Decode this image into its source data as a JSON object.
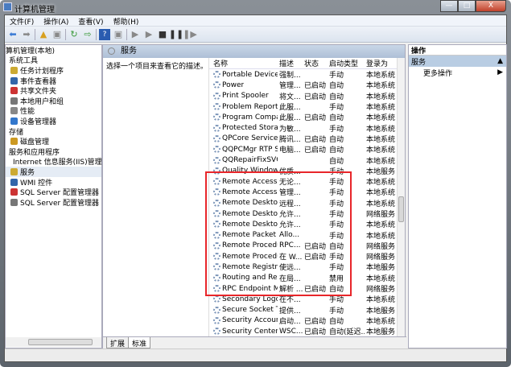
{
  "window": {
    "title": "计算机管理",
    "min": "—",
    "max": "□",
    "close": "X"
  },
  "menu": [
    "文件(F)",
    "操作(A)",
    "查看(V)",
    "帮助(H)"
  ],
  "tree": [
    {
      "label": "算机管理(本地)",
      "level": 0
    },
    {
      "label": "系统工具",
      "level": 1
    },
    {
      "label": "任务计划程序",
      "level": 2
    },
    {
      "label": "事件查看器",
      "level": 2
    },
    {
      "label": "共享文件夹",
      "level": 2
    },
    {
      "label": "本地用户和组",
      "level": 2
    },
    {
      "label": "性能",
      "level": 2
    },
    {
      "label": "设备管理器",
      "level": 2
    },
    {
      "label": "存储",
      "level": 1
    },
    {
      "label": "磁盘管理",
      "level": 2
    },
    {
      "label": "服务和应用程序",
      "level": 1
    },
    {
      "label": "Internet 信息服务(IIS)管理器",
      "level": 2
    },
    {
      "label": "服务",
      "level": 2
    },
    {
      "label": "WMI 控件",
      "level": 2
    },
    {
      "label": "SQL Server 配置管理器",
      "level": 2
    },
    {
      "label": "SQL Server 配置管理器",
      "level": 2
    }
  ],
  "middle": {
    "header": "服务",
    "description": "选择一个项目来查看它的描述。",
    "columns": [
      "名称",
      "描述",
      "状态",
      "启动类型",
      "登录为"
    ],
    "rows": [
      [
        "Portable Device ...",
        "强制...",
        "",
        "手动",
        "本地系统"
      ],
      [
        "Power",
        "管理...",
        "已启动",
        "自动",
        "本地系统"
      ],
      [
        "Print Spooler",
        "将文...",
        "已启动",
        "自动",
        "本地系统"
      ],
      [
        "Problem Report...",
        "此服...",
        "",
        "手动",
        "本地系统"
      ],
      [
        "Program Compa...",
        "此服...",
        "已启动",
        "自动",
        "本地系统"
      ],
      [
        "Protected Storage",
        "为敏...",
        "",
        "手动",
        "本地系统"
      ],
      [
        "QPCore Service",
        "腾讯...",
        "已启动",
        "自动",
        "本地系统"
      ],
      [
        "QQPCMgr RTP S...",
        "电脑...",
        "已启动",
        "自动",
        "本地系统"
      ],
      [
        "QQRepairFixSVC",
        "",
        "",
        "自动",
        "本地系统"
      ],
      [
        "Quality Windows ...",
        "优质...",
        "",
        "手动",
        "本地服务"
      ],
      [
        "Remote Access ...",
        "无论...",
        "",
        "手动",
        "本地系统"
      ],
      [
        "Remote Access ...",
        "管理...",
        "",
        "手动",
        "本地系统"
      ],
      [
        "Remote Deskto...",
        "远程...",
        "",
        "手动",
        "本地系统"
      ],
      [
        "Remote Deskto...",
        "允许...",
        "",
        "手动",
        "网络服务"
      ],
      [
        "Remote Deskto...",
        "允许...",
        "",
        "手动",
        "本地系统"
      ],
      [
        "Remote Packet ...",
        "Allo...",
        "",
        "手动",
        "本地系统"
      ],
      [
        "Remote Procedu...",
        "RPC...",
        "已启动",
        "自动",
        "网络服务"
      ],
      [
        "Remote Procedu...",
        "在 W...",
        "已启动",
        "手动",
        "网络服务"
      ],
      [
        "Remote Registry",
        "使远...",
        "",
        "手动",
        "本地服务"
      ],
      [
        "Routing and Re...",
        "在局...",
        "",
        "禁用",
        "本地系统"
      ],
      [
        "RPC Endpoint M...",
        "解析 ...",
        "已启动",
        "自动",
        "网络服务"
      ],
      [
        "Secondary Logon",
        "在不...",
        "",
        "手动",
        "本地系统"
      ],
      [
        "Secure Socket T...",
        "提供...",
        "",
        "手动",
        "本地服务"
      ],
      [
        "Security Account...",
        "启动...",
        "已启动",
        "自动",
        "本地系统"
      ],
      [
        "Security Center",
        "WSC...",
        "已启动",
        "自动(延迟...",
        "本地服务"
      ]
    ],
    "tabs": [
      "扩展",
      "标准"
    ]
  },
  "actions": {
    "title": "操作",
    "section": "服务",
    "more": "更多操作"
  },
  "colors": {
    "highlight": "#e8262a"
  }
}
